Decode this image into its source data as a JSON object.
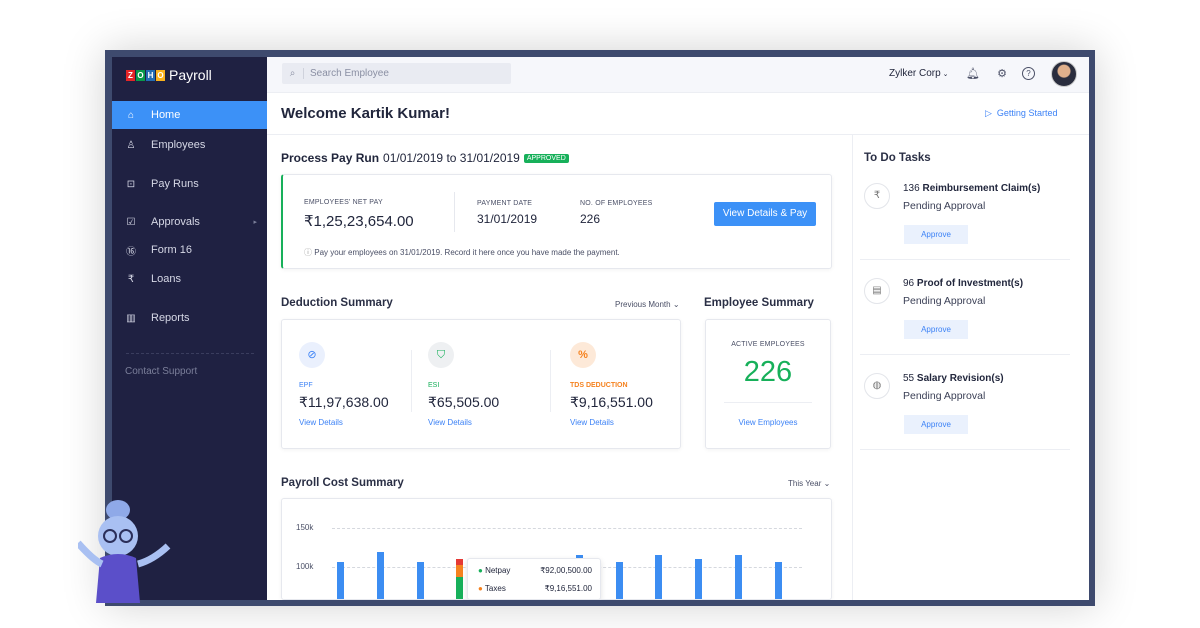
{
  "app": {
    "logo_letters": [
      "Z",
      "O",
      "H",
      "O"
    ],
    "name": "Payroll"
  },
  "sidebar": {
    "items": [
      {
        "label": "Home",
        "icon": "home-icon",
        "active": true
      },
      {
        "label": "Employees",
        "icon": "user-icon"
      },
      {
        "label": "Pay Runs",
        "icon": "pay-runs-icon"
      },
      {
        "label": "Approvals",
        "icon": "approvals-icon"
      },
      {
        "label": "Form 16",
        "icon": "form16-icon"
      },
      {
        "label": "Loans",
        "icon": "rupee-icon"
      },
      {
        "label": "Reports",
        "icon": "reports-icon"
      }
    ],
    "contact_support": "Contact Support"
  },
  "header": {
    "search_placeholder": "Search Employee",
    "org": "Zylker Corp"
  },
  "welcome": "Welcome Kartik Kumar!",
  "getting_started": "Getting Started",
  "payrun": {
    "title": "Process Pay Run",
    "period": "01/01/2019 to 31/01/2019",
    "status": "APPROVED",
    "net_pay_label": "EMPLOYEES' NET PAY",
    "net_pay": "₹1,25,23,654.00",
    "payment_date_label": "PAYMENT DATE",
    "payment_date": "31/01/2019",
    "employees_label": "NO. OF EMPLOYEES",
    "employees": "226",
    "button": "View Details & Pay",
    "note": "Pay your employees on 31/01/2019. Record it here once you have made the payment."
  },
  "deduction": {
    "title": "Deduction Summary",
    "filter": "Previous Month",
    "items": [
      {
        "label": "EPF",
        "value": "₹11,97,638.00",
        "link": "View Details",
        "color": "#3c82f6"
      },
      {
        "label": "ESI",
        "value": "₹65,505.00",
        "link": "View Details",
        "color": "#17b05a"
      },
      {
        "label": "TDS DEDUCTION",
        "value": "₹9,16,551.00",
        "link": "View Details",
        "color": "#f5821f"
      }
    ]
  },
  "employee_summary": {
    "title": "Employee Summary",
    "label": "ACTIVE EMPLOYEES",
    "count": "226",
    "link": "View Employees"
  },
  "todo": {
    "title": "To Do Tasks",
    "tasks": [
      {
        "count": "136",
        "name": "Reimbursement Claim(s)",
        "status": "Pending Approval",
        "button": "Approve"
      },
      {
        "count": "96",
        "name": "Proof of Investment(s)",
        "status": "Pending Approval",
        "button": "Approve"
      },
      {
        "count": "55",
        "name": "Salary Revision(s)",
        "status": "Pending Approval",
        "button": "Approve"
      }
    ]
  },
  "payroll_cost": {
    "title": "Payroll Cost Summary",
    "filter": "This Year"
  },
  "chart_data": {
    "type": "bar",
    "yticks": [
      "150k",
      "100k"
    ],
    "ylim_visible": [
      100000,
      150000
    ],
    "values": [
      107000,
      119000,
      107000,
      110000,
      null,
      null,
      116000,
      107000,
      116000,
      110000,
      116000,
      107000
    ],
    "bar_color": "#3c8df2",
    "highlight_index": 3,
    "tooltip": [
      {
        "name": "Netpay",
        "value": "₹92,00,500.00",
        "color": "#17b05a"
      },
      {
        "name": "Taxes",
        "value": "₹9,16,551.00",
        "color": "#f5821f"
      }
    ]
  }
}
